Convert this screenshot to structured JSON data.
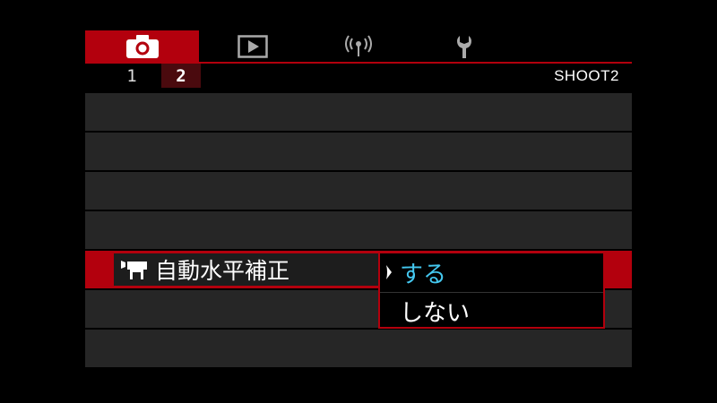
{
  "tabs": [
    {
      "icon": "camera-icon",
      "active": true
    },
    {
      "icon": "playback-icon",
      "active": false
    },
    {
      "icon": "wireless-icon",
      "active": false
    },
    {
      "icon": "wrench-icon",
      "active": false
    }
  ],
  "subtabs": [
    "1",
    "2"
  ],
  "selected_subtab": "2",
  "menu_page_label": "SHOOT2",
  "menu_item": {
    "icon": "movie-camera-icon",
    "label": "自動水平補正"
  },
  "options": {
    "selected": "する",
    "items": [
      "する",
      "しない"
    ]
  },
  "colors": {
    "accent": "#b3000d",
    "row_bg": "#262626",
    "selected_text": "#44c8f0"
  }
}
